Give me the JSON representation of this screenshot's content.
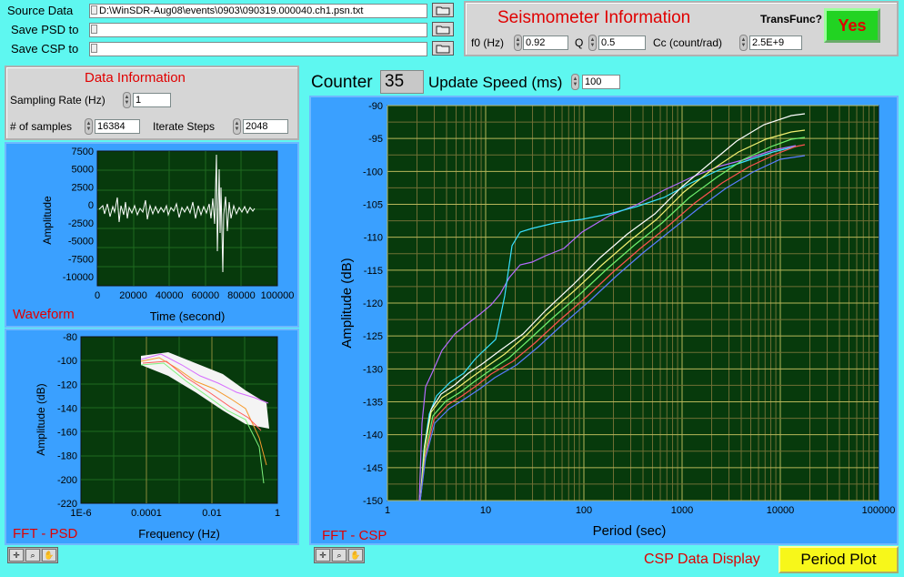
{
  "files": {
    "source_label": "Source Data",
    "source_value": "D:\\WinSDR-Aug08\\events\\0903\\090319.000040.ch1.psn.txt",
    "psd_label": "Save PSD to",
    "psd_value": "",
    "csp_label": "Save CSP to",
    "csp_value": ""
  },
  "seismometer": {
    "title": "Seismometer Information",
    "transfunc_label": "TransFunc?",
    "yes_label": "Yes",
    "f0_label": "f0 (Hz)",
    "f0_value": "0.92",
    "q_label": "Q",
    "q_value": "0.5",
    "cc_label": "Cc (count/rad)",
    "cc_value": "2.5E+9"
  },
  "data_info": {
    "title": "Data Information",
    "sampling_label": "Sampling Rate (Hz)",
    "sampling_value": "1",
    "samples_label": "# of samples",
    "samples_value": "16384",
    "iterate_label": "Iterate Steps",
    "iterate_value": "2048"
  },
  "counter": {
    "label": "Counter",
    "value": "35",
    "speed_label": "Update Speed (ms)",
    "speed_value": "100"
  },
  "waveform": {
    "title": "Waveform",
    "xlabel": "Time (second)",
    "ylabel": "Amplitude",
    "xticks": [
      "0",
      "20000",
      "40000",
      "60000",
      "80000",
      "100000"
    ],
    "yticks": [
      "7500",
      "5000",
      "2500",
      "0",
      "-2500",
      "-5000",
      "-7500",
      "-10000"
    ]
  },
  "psd": {
    "title": "FFT - PSD",
    "xlabel": "Frequency (Hz)",
    "ylabel": "Amplitude (dB)",
    "xticks": [
      "1E-6",
      "0.0001",
      "0.01",
      "1"
    ],
    "yticks": [
      "-80",
      "-100",
      "-120",
      "-140",
      "-160",
      "-180",
      "-200",
      "-220"
    ]
  },
  "csp": {
    "title": "FFT - CSP",
    "xlabel": "Period (sec)",
    "ylabel": "Amplitude (dB)",
    "xticks": [
      "1",
      "10",
      "100",
      "1000",
      "10000",
      "100000"
    ],
    "yticks": [
      "-90",
      "-95",
      "-100",
      "-105",
      "-110",
      "-115",
      "-120",
      "-125",
      "-130",
      "-135",
      "-140",
      "-145",
      "-150"
    ]
  },
  "display": {
    "label": "CSP Data Display",
    "button": "Period Plot"
  },
  "colors": {
    "background": "#5ef7f0",
    "plot_bg": "#073a0c",
    "panel_blue": "#3aa0ff",
    "title_red": "#e00000",
    "yes_green": "#22d322",
    "period_yellow": "#f7f71a"
  },
  "icons": [
    "folder-icon",
    "zoom-icon",
    "crosshair-icon",
    "hand-icon"
  ]
}
